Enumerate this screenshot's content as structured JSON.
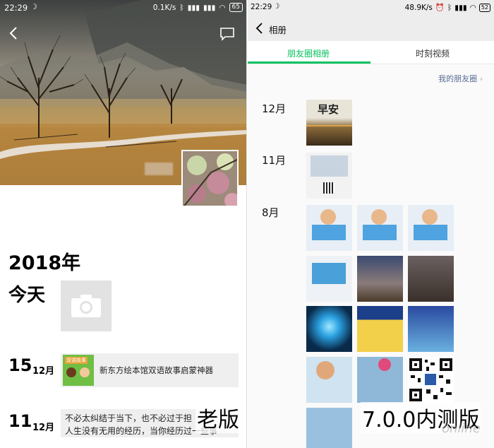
{
  "old": {
    "statusbar": {
      "time": "22:29",
      "speed": "0.1K/s",
      "battery": "65"
    },
    "year": "2018年",
    "today": "今天",
    "posts": [
      {
        "day": "15",
        "month": "12月",
        "text": "新东方绘本馆双语故事启蒙神器",
        "thumb_text": "双语故事"
      },
      {
        "day": "11",
        "month": "12月",
        "line1": "不必太纠结于当下，也不必过于担",
        "line2": "人生没有无用的经历，当你经历过一些事"
      }
    ],
    "label": "老版"
  },
  "new": {
    "statusbar": {
      "time": "22:29",
      "speed": "48.9K/s",
      "battery": "52"
    },
    "title": "相册",
    "tabs": [
      "朋友圈相册",
      "时刻视频"
    ],
    "active_tab": 0,
    "my_moments": "我的朋友圈",
    "months": [
      "12月",
      "11月",
      "8月"
    ],
    "photo_text": {
      "zaoan": "早安",
      "zaoan2": "早安"
    },
    "label": "7.0.0内测版",
    "watermark": "online"
  },
  "colors": {
    "accent": "#07c160",
    "link": "#576b95"
  }
}
